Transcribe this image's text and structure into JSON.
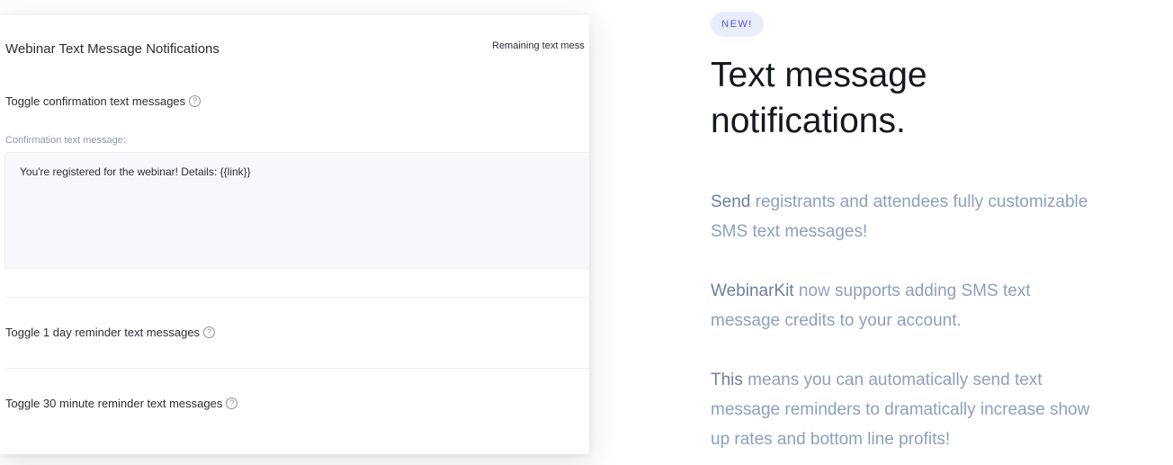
{
  "card": {
    "title": "Webinar Text Message Notifications",
    "remaining": "Remaining text mess",
    "toggle_confirmation": "Toggle confirmation text messages",
    "confirmation_label": "Confirmation text message:",
    "confirmation_value": "You're registered for the webinar! Details: {{link}}",
    "toggle_1day": "Toggle 1 day reminder text messages",
    "toggle_30min": "Toggle 30 minute reminder text messages",
    "help_glyph": "?"
  },
  "promo": {
    "badge": "NEW!",
    "headline_line1": "Text message",
    "headline_line2": "notifications.",
    "p1_lead": "Send",
    "p1_rest": " registrants and attendees fully customizable SMS text messages!",
    "p2_lead": "WebinarKit",
    "p2_rest": " now supports adding SMS text message credits to your account.",
    "p3_lead": "This",
    "p3_rest": " means you can automatically send text message reminders to dramatically increase show up rates and bottom line profits!"
  },
  "colors": {
    "badge_bg": "#e9edfb",
    "badge_text": "#4a5ad8",
    "headline": "#141820",
    "body_text": "#8e9fbe",
    "field_label": "#8d9bb3"
  },
  "icons": {
    "help": "question-circle-icon"
  }
}
